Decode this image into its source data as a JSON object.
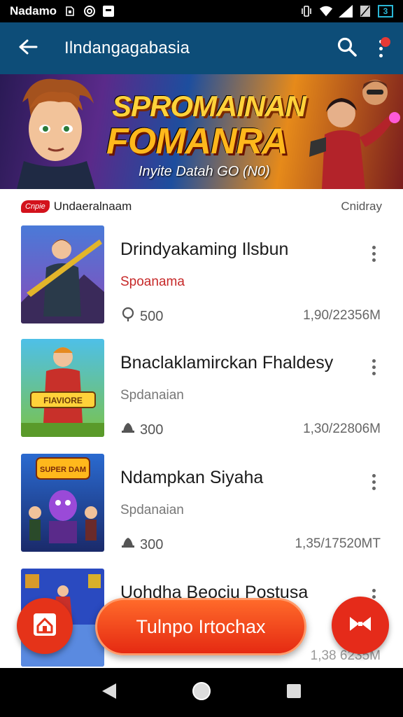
{
  "status_bar": {
    "carrier": "Nadamo",
    "battery": "3",
    "icons": [
      "sim-icon",
      "at-icon",
      "message-icon",
      "vibrate-icon",
      "wifi-icon",
      "signal-icon",
      "no-sim-icon",
      "battery-icon"
    ]
  },
  "app_bar": {
    "title": "Ilndangagabasia",
    "icons": [
      "back-arrow-icon",
      "search-icon",
      "more-vertical-icon"
    ],
    "color": "#0d4d78"
  },
  "banner": {
    "title_line1": "SPROMAINAN",
    "title_line2": "FOMANRA",
    "subtitle": "Inyite Datah GO (N0)"
  },
  "section": {
    "badge": "Cnpie",
    "title": "Undaeralnaam",
    "action": "Cnidray"
  },
  "items": [
    {
      "title": "Drindyakaming Ilsbun",
      "subtitle": "Spoanama",
      "rating": "500",
      "size": "1,90/22356M",
      "rating_icon": "pin-icon",
      "subtitle_red": true
    },
    {
      "title": "Bnaclaklamirckan Fhaldesy",
      "subtitle": "Spdanaian",
      "rating": "300",
      "size": "1,30/22806M",
      "rating_icon": "bell-icon",
      "subtitle_red": false
    },
    {
      "title": "Ndampkan Siyaha",
      "subtitle": "Spdanaian",
      "rating": "300",
      "size": "1,35/17520MT",
      "rating_icon": "bell-icon",
      "subtitle_red": false
    },
    {
      "title": "Uohdha Beociu Postusa",
      "subtitle": "",
      "rating": "",
      "size": "",
      "rating_icon": "",
      "subtitle_red": false
    }
  ],
  "thumb_labels": [
    "FIAVIORE",
    "SUPER DAM"
  ],
  "fab": {
    "main_label": "Tulnpo Irtochax",
    "left_icon": "home-icon",
    "right_icon": "bowtie-icon",
    "faded_size": "1,38 6235M"
  },
  "nav_bar": {
    "icons": [
      "back-triangle-icon",
      "home-circle-icon",
      "recents-square-icon"
    ]
  },
  "colors": {
    "accent": "#e53319",
    "app_bar": "#0d4d78",
    "subtitle_red": "#c62828"
  }
}
